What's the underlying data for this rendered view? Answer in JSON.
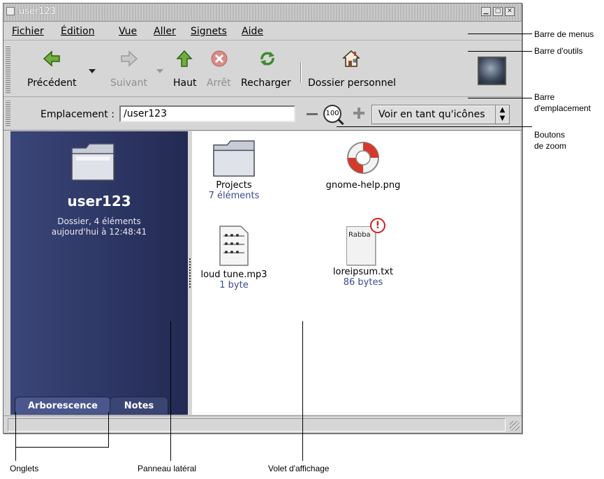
{
  "window": {
    "title": "user123"
  },
  "menubar": {
    "items": [
      "Fichier",
      "Édition",
      "Vue",
      "Aller",
      "Signets",
      "Aide"
    ]
  },
  "toolbar": {
    "back": "Précédent",
    "forward": "Suivant",
    "up": "Haut",
    "stop": "Arrêt",
    "reload": "Recharger",
    "home": "Dossier personnel"
  },
  "location": {
    "label": "Emplacement :",
    "value": "/user123",
    "zoom_level": "100",
    "view_mode": "Voir en tant qu'icônes"
  },
  "sidepane": {
    "name": "user123",
    "meta_line1": "Dossier, 4 éléments",
    "meta_line2": "aujourd'hui à 12:48:41"
  },
  "tabs": [
    "Arborescence",
    "Notes"
  ],
  "files": [
    {
      "name": "Projects",
      "info": "7 éléments",
      "icon": "folder-icon"
    },
    {
      "name": "gnome-help.png",
      "info": "",
      "icon": "lifebuoy-icon"
    },
    {
      "name": "loud tune.mp3",
      "info": "1 byte",
      "icon": "music-file-icon"
    },
    {
      "name": "loreipsum.txt",
      "info": "86 bytes",
      "icon": "text-file-icon",
      "preview_text": "Rabba",
      "emblem": "important-emblem-icon"
    }
  ],
  "callouts": {
    "menubar": "Barre de menus",
    "toolbar": "Barre d'outils",
    "locbar_1": "Barre",
    "locbar_2": "d'emplacement",
    "zoom_1": "Boutons",
    "zoom_2": "de zoom",
    "tabs": "Onglets",
    "sidepane": "Panneau latéral",
    "viewpane": "Volet d'affichage"
  }
}
